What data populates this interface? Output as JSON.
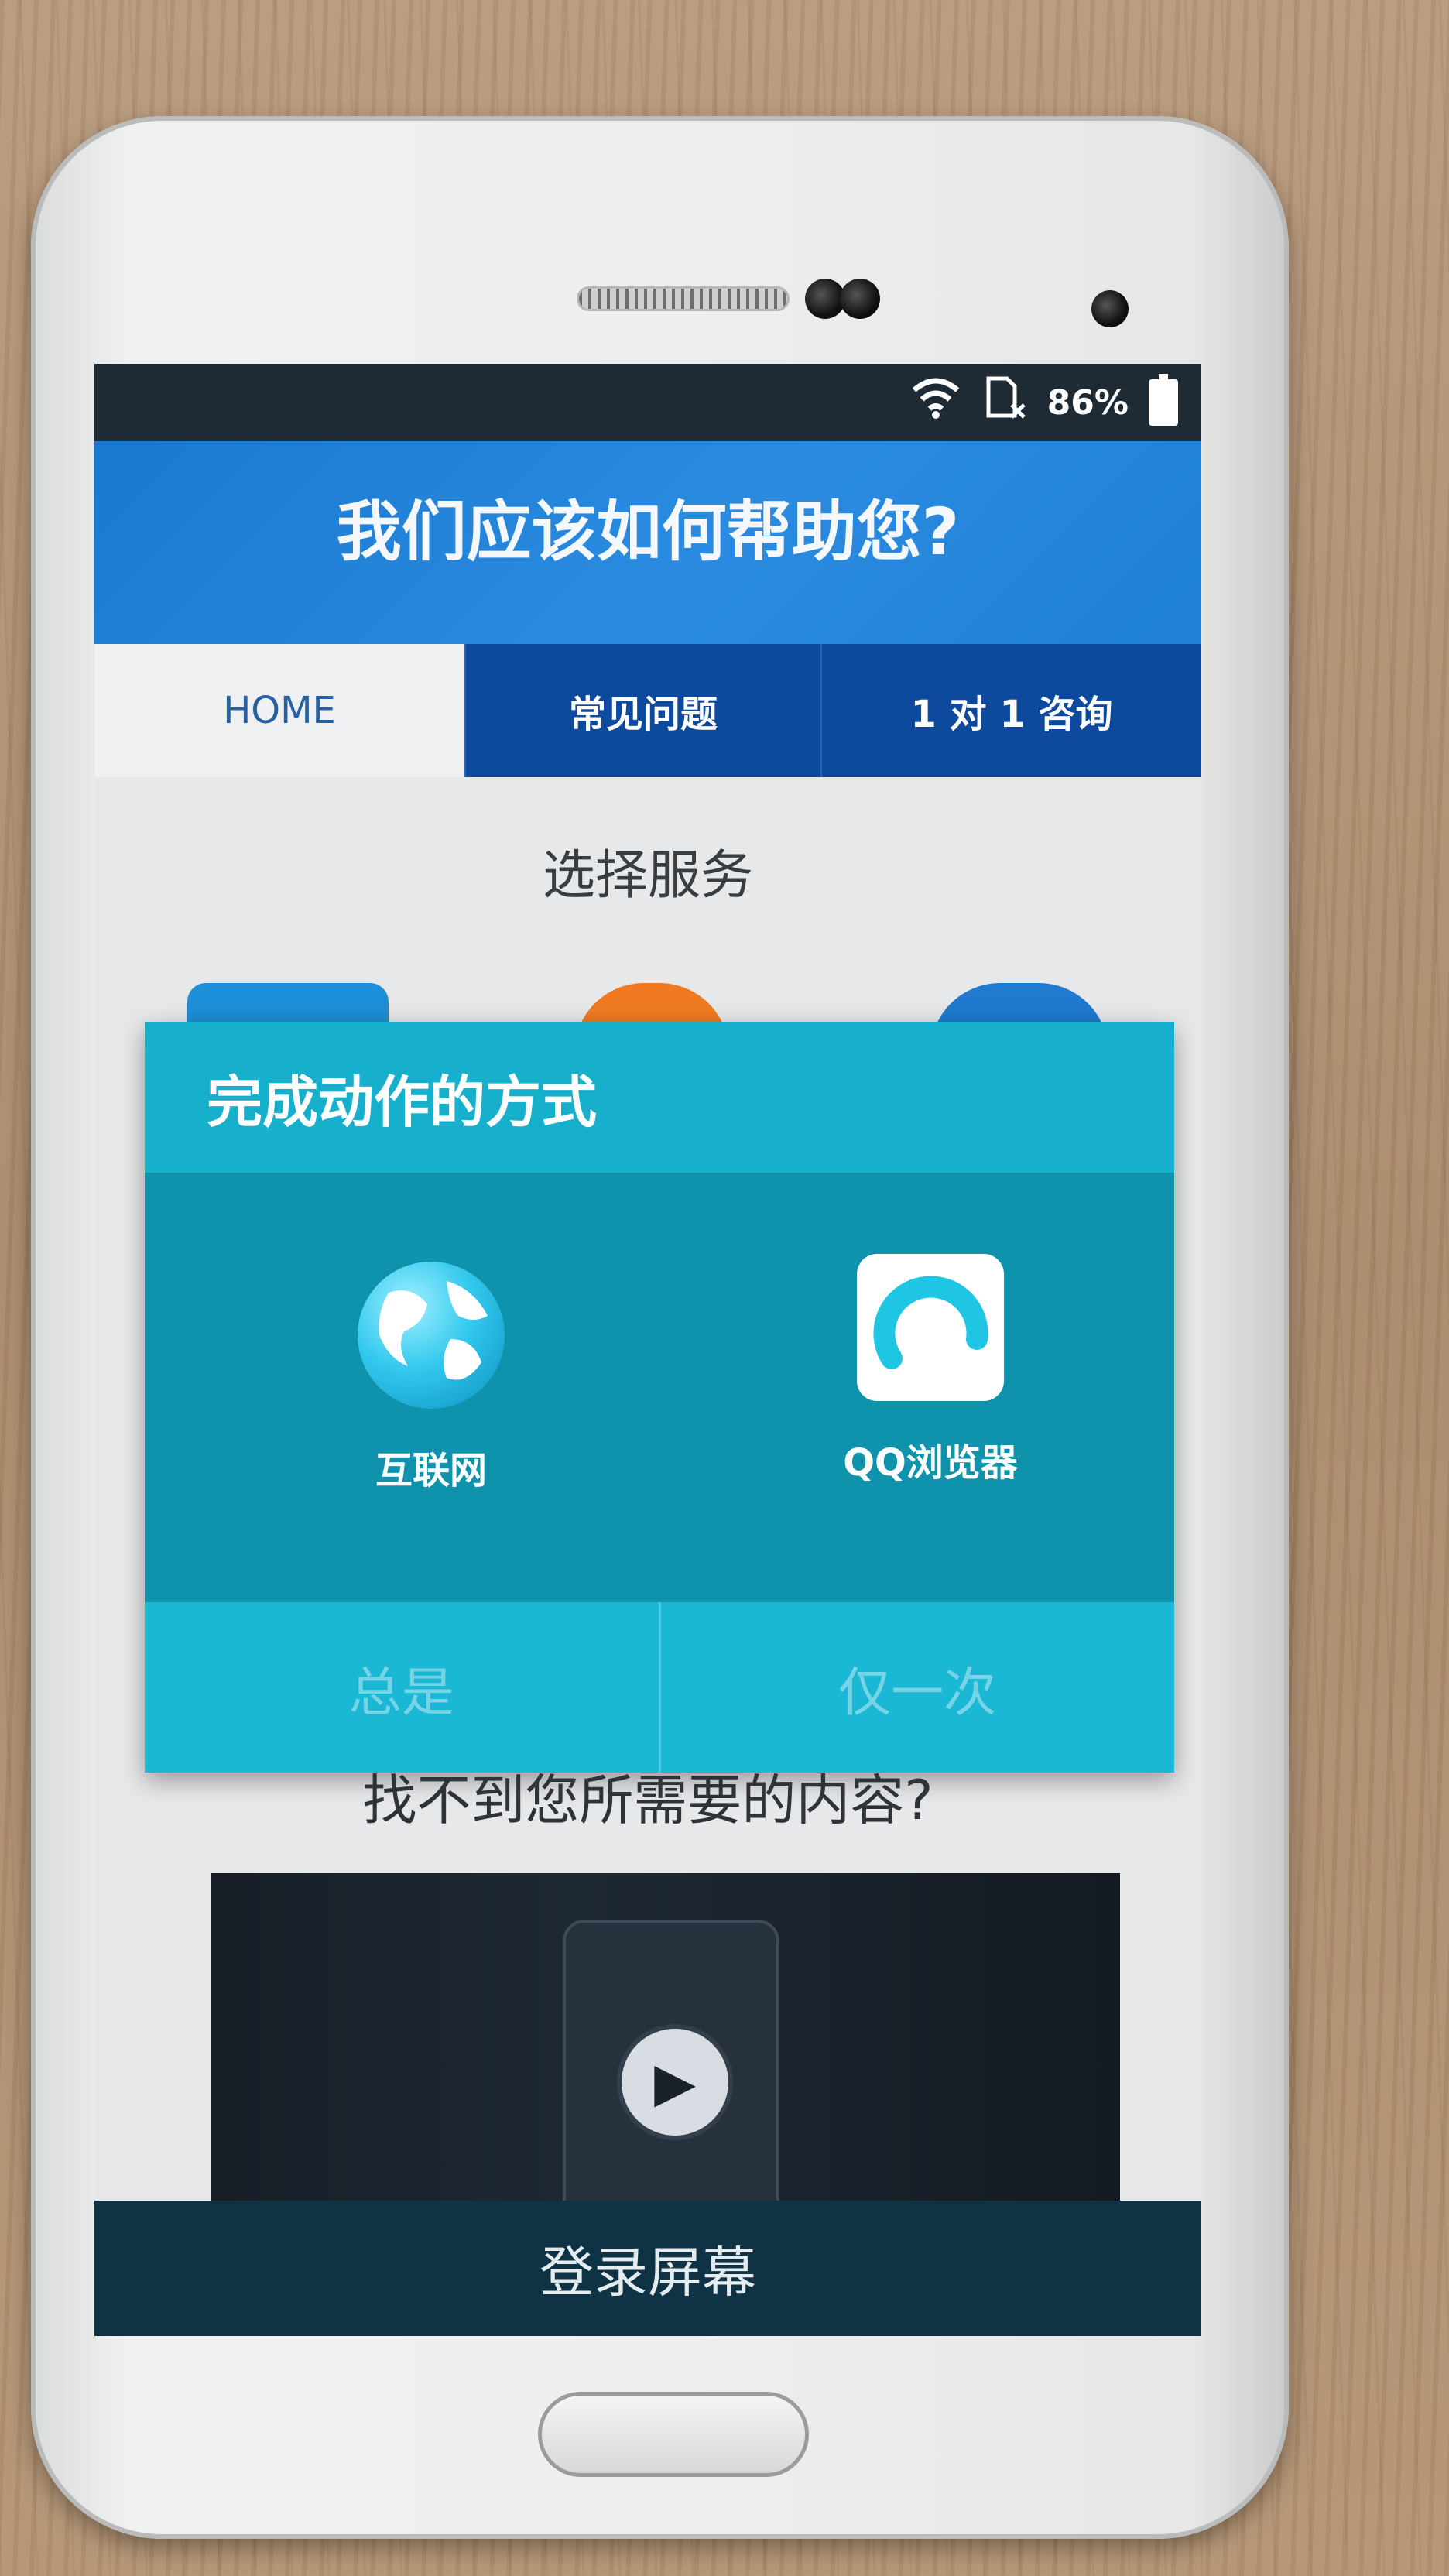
{
  "status_bar": {
    "battery_percent": "86%",
    "icons": [
      "wifi-icon",
      "no-sim-icon",
      "battery-icon"
    ]
  },
  "header": {
    "title": "我们应该如何帮助您?"
  },
  "tabs": [
    {
      "label": "HOME",
      "active": true
    },
    {
      "label": "常见问题",
      "active": false
    },
    {
      "label": "1 对 1 咨询",
      "active": false
    }
  ],
  "main": {
    "section_title": "选择服务",
    "help_title": "找不到您所需要的内容?"
  },
  "dialog": {
    "title": "完成动作的方式",
    "options": [
      {
        "label": "互联网",
        "icon": "globe-icon"
      },
      {
        "label": "QQ浏览器",
        "icon": "qq-browser-icon"
      }
    ],
    "buttons": {
      "always": "总是",
      "just_once": "仅一次"
    }
  },
  "bottom_bar": {
    "label": "登录屏幕"
  },
  "colors": {
    "header_blue": "#1a79cf",
    "tab_blue": "#0d4a9e",
    "dialog_teal": "#0f92ab",
    "dialog_header": "#17b0cc",
    "bottom_bar": "#0f3344"
  }
}
